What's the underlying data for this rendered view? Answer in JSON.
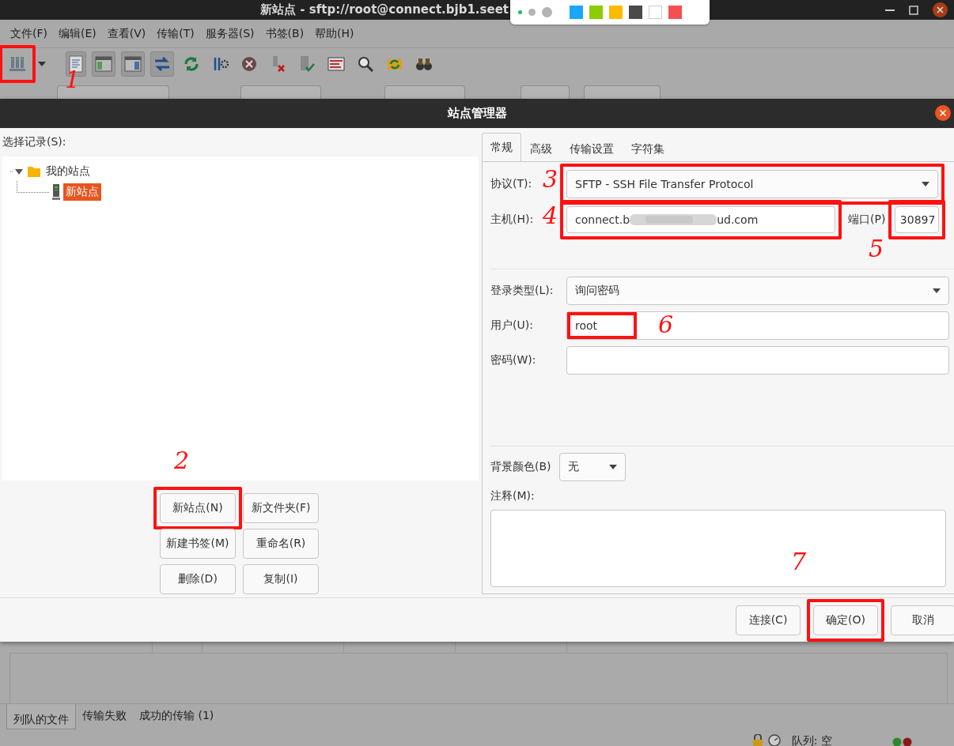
{
  "window": {
    "title": "新站点 - sftp://root@connect.bjb1.seet"
  },
  "capture_toolbar": {
    "pens": [
      {
        "kind": "small",
        "selected": true
      },
      {
        "kind": "medium",
        "selected": false
      },
      {
        "kind": "large",
        "selected": false
      }
    ],
    "swatches": [
      {
        "color": "#1aa7fa"
      },
      {
        "color": "#8ccc00"
      },
      {
        "color": "#ffbb00"
      },
      {
        "color": "#4a4a4a"
      },
      {
        "color": "#ffffff"
      },
      {
        "color": "#f55050"
      }
    ]
  },
  "menu": [
    "文件(F)",
    "编辑(E)",
    "查看(V)",
    "传输(T)",
    "服务器(S)",
    "书签(B)",
    "帮助(H)"
  ],
  "toolbar": [
    {
      "kind": "sites",
      "pressed": false,
      "highlighted": true,
      "annotation": "1"
    },
    {
      "kind": "dropdown",
      "pressed": false
    },
    {
      "kind": "log",
      "pressed": true
    },
    {
      "kind": "local-tree",
      "pressed": true
    },
    {
      "kind": "remote-tree",
      "pressed": true
    },
    {
      "kind": "queue",
      "pressed": true
    },
    {
      "kind": "refresh",
      "pressed": false
    },
    {
      "kind": "process",
      "pressed": false
    },
    {
      "kind": "cancel",
      "pressed": false
    },
    {
      "kind": "disconnect",
      "pressed": false
    },
    {
      "kind": "reconnect",
      "pressed": false
    },
    {
      "kind": "filter",
      "pressed": false
    },
    {
      "kind": "compare",
      "pressed": false
    },
    {
      "kind": "sync",
      "pressed": false
    },
    {
      "kind": "find",
      "pressed": false
    }
  ],
  "dialog": {
    "title": "站点管理器",
    "tree_label": "选择记录(S):",
    "tree": [
      {
        "label": "我的站点",
        "kind": "folder",
        "expanded": true,
        "selected": false,
        "children": [
          {
            "label": "新站点",
            "kind": "site",
            "selected": true
          }
        ]
      }
    ],
    "left_buttons": [
      {
        "label": "新站点(N)",
        "highlighted": true,
        "annotation": "2"
      },
      {
        "label": "新文件夹(F)"
      },
      {
        "label": "新建书签(M)"
      },
      {
        "label": "重命名(R)"
      },
      {
        "label": "删除(D)"
      },
      {
        "label": "复制(I)"
      }
    ],
    "tabs": [
      {
        "label": "常规",
        "selected": true
      },
      {
        "label": "高级",
        "selected": false
      },
      {
        "label": "传输设置",
        "selected": false
      },
      {
        "label": "字符集",
        "selected": false
      }
    ],
    "protocol": {
      "label": "协议(T):",
      "value": "SFTP - SSH File Transfer Protocol",
      "highlighted": true,
      "annotation": "3"
    },
    "host": {
      "label": "主机(H):",
      "value_start": "connect.b",
      "value_end": "ud.com",
      "highlighted": true,
      "annotation": "4"
    },
    "port": {
      "label": "端口(P)",
      "value": "30897",
      "highlighted": true,
      "annotation": "5"
    },
    "logon_type": {
      "label": "登录类型(L):",
      "value": "询问密码"
    },
    "user": {
      "label": "用户(U):",
      "value": "root",
      "highlighted": true,
      "annotation": "6"
    },
    "password": {
      "label": "密码(W):"
    },
    "background_color": {
      "label": "背景颜色(B)",
      "value": "无"
    },
    "comments": {
      "label": "注释(M):"
    },
    "footer_buttons": [
      {
        "label": "连接(C)"
      },
      {
        "label": "确定(O)",
        "highlighted": true,
        "annotation": "7"
      },
      {
        "label": "取消"
      }
    ]
  },
  "queue_tabs": [
    {
      "label": "列队的文件",
      "selected": true
    },
    {
      "label": "传输失败",
      "selected": false
    },
    {
      "label": "成功的传输 (1)",
      "selected": false
    }
  ],
  "status_bar": {
    "queue": "队列: 空"
  }
}
